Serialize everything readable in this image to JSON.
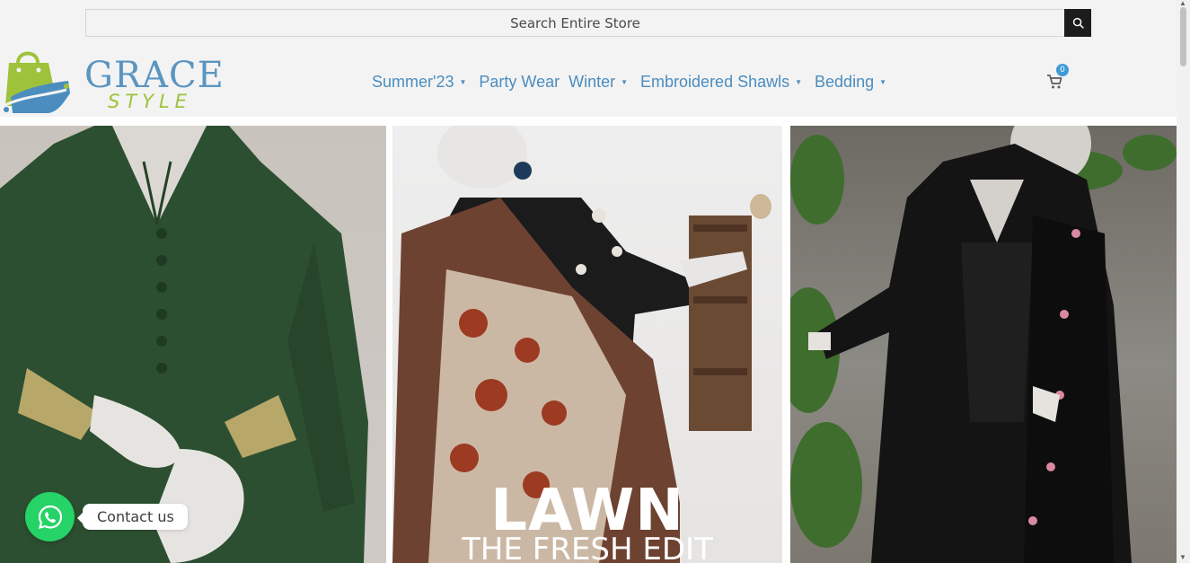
{
  "search": {
    "placeholder": "Search Entire Store"
  },
  "logo": {
    "line1": "GRACE",
    "line2": "STYLE"
  },
  "nav": {
    "items": [
      {
        "label": "Summer'23",
        "has_dropdown": true
      },
      {
        "label": "Party Wear",
        "has_dropdown": false
      },
      {
        "label": "Winter",
        "has_dropdown": true
      },
      {
        "label": "Embroidered Shawls",
        "has_dropdown": true
      },
      {
        "label": "Bedding",
        "has_dropdown": true
      }
    ]
  },
  "cart": {
    "count": "0",
    "icon": "cart-icon"
  },
  "banners": [
    {
      "name": "green-suit-banner"
    },
    {
      "name": "lawn-banner",
      "title": "LAWN",
      "subtitle": "THE FRESH EDIT"
    },
    {
      "name": "black-embroidered-banner"
    }
  ],
  "contact": {
    "label": "Contact us",
    "icon": "whatsapp-icon"
  },
  "colors": {
    "accent": "#4b8dbf",
    "logo_green": "#9ec23a",
    "whatsapp": "#25d366",
    "badge": "#3f9ad6"
  }
}
